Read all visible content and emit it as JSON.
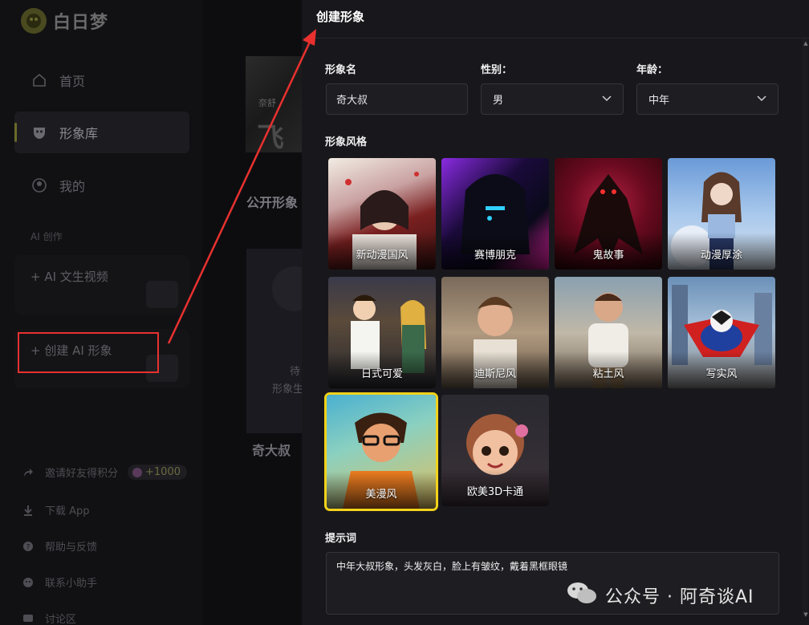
{
  "app": {
    "name": "白日梦"
  },
  "sidebar": {
    "nav": [
      {
        "label": "首页"
      },
      {
        "label": "形象库"
      },
      {
        "label": "我的"
      }
    ],
    "section_label": "AI 创作",
    "ai_text_video": "+ AI 文生视频",
    "ai_create_character": "+ 创建 AI 形象",
    "bottom_links": [
      {
        "label": "邀请好友得积分",
        "badge": "+1000"
      },
      {
        "label": "下载 App"
      },
      {
        "label": "帮助与反馈"
      },
      {
        "label": "联系小助手"
      },
      {
        "label": "讨论区"
      }
    ]
  },
  "main": {
    "banner_small": "奈舒",
    "banner_big": "飞风",
    "public_title": "公开形象",
    "card_line1": "待",
    "card_line2": "形象生",
    "card_name": "奇大叔"
  },
  "modal": {
    "title": "创建形象",
    "name_label": "形象名",
    "name_value": "奇大叔",
    "gender_label": "性别：",
    "gender_value": "男",
    "age_label": "年龄：",
    "age_value": "中年",
    "style_label": "形象风格",
    "styles": [
      {
        "name": "新动漫国风",
        "selected": false
      },
      {
        "name": "赛博朋克",
        "selected": false
      },
      {
        "name": "鬼故事",
        "selected": false
      },
      {
        "name": "动漫厚涂",
        "selected": false
      },
      {
        "name": "日式可爱",
        "selected": false
      },
      {
        "name": "迪斯尼风",
        "selected": false
      },
      {
        "name": "粘土风",
        "selected": false
      },
      {
        "name": "写实风",
        "selected": false
      },
      {
        "name": "美漫风",
        "selected": true
      },
      {
        "name": "欧美3D卡通",
        "selected": false
      }
    ],
    "prompt_label": "提示词",
    "prompt_value": "中年大叔形象，头发灰白，脸上有皱纹，戴着黑框眼镜"
  },
  "watermark": "公众号 · 阿奇谈AI",
  "colors": {
    "highlight_red": "#e8312f",
    "selected_yellow": "#f2d21b",
    "modal_bg": "#18181c"
  }
}
